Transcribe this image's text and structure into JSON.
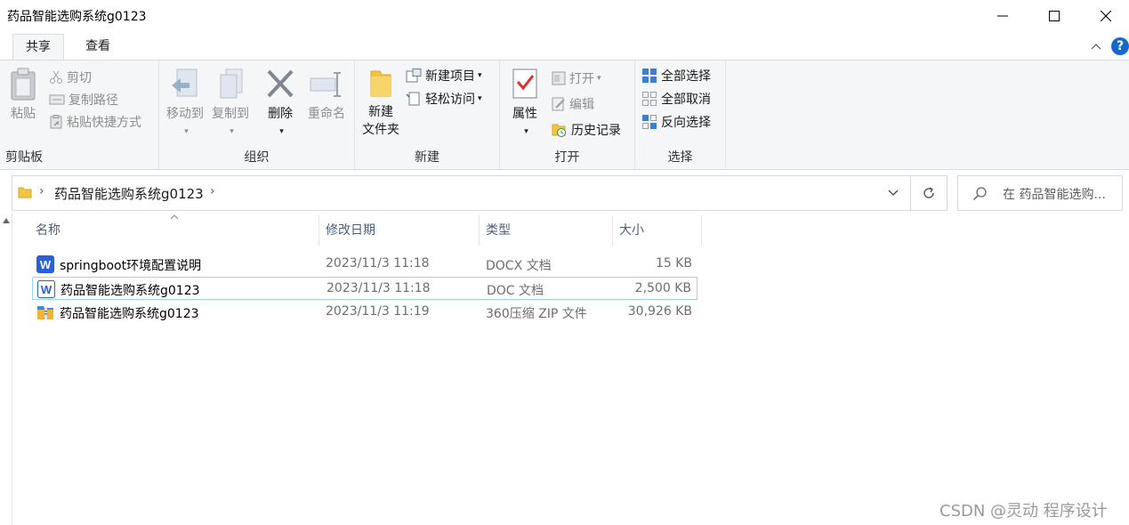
{
  "window": {
    "title": "药品智能选购系统g0123",
    "minimize_icon": "minimize-icon",
    "maximize_icon": "maximize-icon",
    "close_icon": "close-icon"
  },
  "tabs": [
    {
      "label": "共享",
      "active": true
    },
    {
      "label": "查看",
      "active": false
    }
  ],
  "ribbon": {
    "clipboard": {
      "group_label": "剪贴板",
      "paste": "粘贴",
      "cut": "剪切",
      "copy_path": "复制路径",
      "paste_shortcut": "粘贴快捷方式"
    },
    "organize": {
      "group_label": "组织",
      "move_to": "移动到",
      "copy_to": "复制到",
      "delete": "删除",
      "rename": "重命名"
    },
    "new": {
      "group_label": "新建",
      "new_folder_line1": "新建",
      "new_folder_line2": "文件夹",
      "new_item": "新建项目",
      "easy_access": "轻松访问"
    },
    "open": {
      "group_label": "打开",
      "properties": "属性",
      "open": "打开",
      "edit": "编辑",
      "history": "历史记录"
    },
    "select": {
      "group_label": "选择",
      "select_all": "全部选择",
      "select_none": "全部取消",
      "invert_selection": "反向选择"
    }
  },
  "address": {
    "crumb": "药品智能选购系统g0123",
    "search_placeholder": "在 药品智能选购..."
  },
  "columns": {
    "name": "名称",
    "date": "修改日期",
    "type": "类型",
    "size": "大小"
  },
  "files": [
    {
      "name": "springboot环境配置说明",
      "date": "2023/11/3 11:18",
      "type": "DOCX 文档",
      "size": "15 KB",
      "icon": "word-docx-icon"
    },
    {
      "name": "药品智能选购系统g0123",
      "date": "2023/11/3 11:18",
      "type": "DOC 文档",
      "size": "2,500 KB",
      "icon": "word-doc-icon"
    },
    {
      "name": "药品智能选购系统g0123",
      "date": "2023/11/3 11:19",
      "type": "360压缩 ZIP 文件",
      "size": "30,926 KB",
      "icon": "zip-archive-icon"
    }
  ],
  "watermark": "CSDN @灵动 程序设计",
  "colors": {
    "word_blue": "#2b5fd9",
    "selection_border": "#99d1ff",
    "help_blue": "#1668c8",
    "ribbon_bg": "#f5f6f7"
  }
}
